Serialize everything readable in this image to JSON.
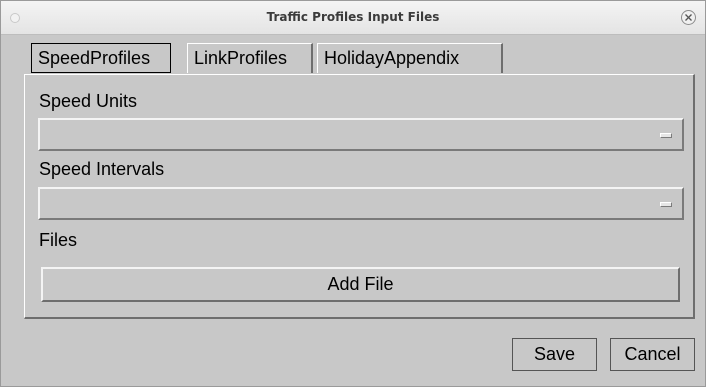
{
  "window": {
    "title": "Traffic Profiles Input Files"
  },
  "tabs": [
    {
      "label": "SpeedProfiles",
      "active": true
    },
    {
      "label": "LinkProfiles",
      "active": false
    },
    {
      "label": "HolidayAppendix",
      "active": false
    }
  ],
  "speed_profiles": {
    "speed_units_label": "Speed Units",
    "speed_units_value": "",
    "speed_intervals_label": "Speed Intervals",
    "speed_intervals_value": "",
    "files_label": "Files",
    "add_file_label": "Add File"
  },
  "footer": {
    "save_label": "Save",
    "cancel_label": "Cancel"
  },
  "icons": {
    "close": "close-icon",
    "window_menu": "window-menu-dot-icon",
    "combo_indicator": "option-menu-indicator-icon"
  },
  "colors": {
    "window_bg": "#c8c8c8",
    "titlebar_bg": "#ececec"
  }
}
